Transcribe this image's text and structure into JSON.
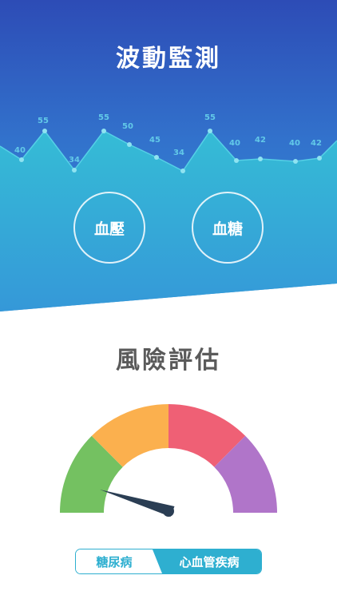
{
  "hero": {
    "title": "波動監測",
    "wave_values": [
      "40",
      "55",
      "34",
      "55",
      "50",
      "45",
      "34",
      "55",
      "40",
      "42",
      "40",
      "42"
    ],
    "buttons": {
      "blood_pressure": "血壓",
      "blood_sugar": "血糖"
    }
  },
  "risk": {
    "title": "風險評估",
    "gauge_colors": [
      "#74c161",
      "#fbb04e",
      "#ef6075",
      "#b075c9"
    ],
    "toggle": {
      "left_label": "糖尿病",
      "right_label": "心血管疾病",
      "selected": "心血管疾病"
    }
  },
  "colors": {
    "accent": "#2eafd0",
    "hero_top": "#2f4fb8",
    "hero_bottom": "#35a7da"
  }
}
